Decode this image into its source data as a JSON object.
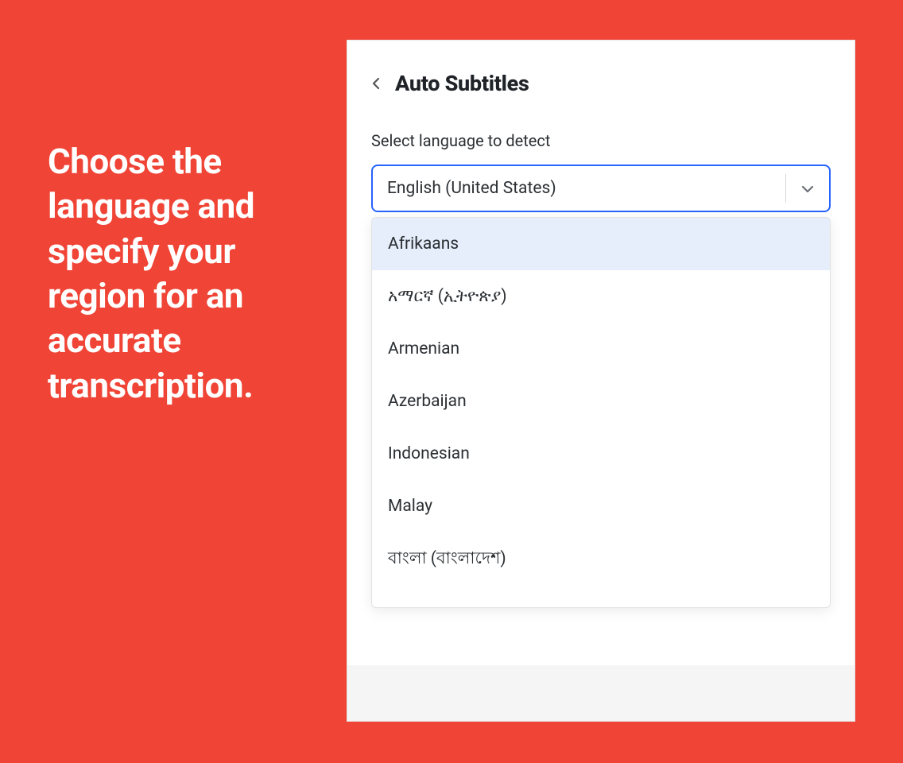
{
  "promo": {
    "heading": "Choose the language and specify your region for an accurate transcription."
  },
  "panel": {
    "title": "Auto Subtitles",
    "label": "Select language to detect",
    "selected": "English (United States)"
  },
  "dropdown": {
    "options": [
      "Afrikaans",
      "አማርኛ (ኢትዮጵያ)",
      "Armenian",
      "Azerbaijan",
      "Indonesian",
      "Malay",
      "বাংলা (বাংলাদেশ)"
    ]
  }
}
